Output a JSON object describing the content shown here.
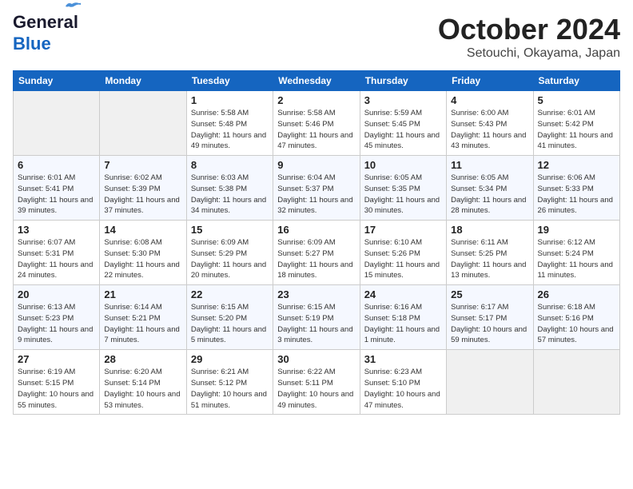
{
  "header": {
    "logo_line1": "General",
    "logo_line2": "Blue",
    "month": "October 2024",
    "location": "Setouchi, Okayama, Japan"
  },
  "weekdays": [
    "Sunday",
    "Monday",
    "Tuesday",
    "Wednesday",
    "Thursday",
    "Friday",
    "Saturday"
  ],
  "weeks": [
    [
      {
        "day": "",
        "sunrise": "",
        "sunset": "",
        "daylight": ""
      },
      {
        "day": "",
        "sunrise": "",
        "sunset": "",
        "daylight": ""
      },
      {
        "day": "1",
        "sunrise": "Sunrise: 5:58 AM",
        "sunset": "Sunset: 5:48 PM",
        "daylight": "Daylight: 11 hours and 49 minutes."
      },
      {
        "day": "2",
        "sunrise": "Sunrise: 5:58 AM",
        "sunset": "Sunset: 5:46 PM",
        "daylight": "Daylight: 11 hours and 47 minutes."
      },
      {
        "day": "3",
        "sunrise": "Sunrise: 5:59 AM",
        "sunset": "Sunset: 5:45 PM",
        "daylight": "Daylight: 11 hours and 45 minutes."
      },
      {
        "day": "4",
        "sunrise": "Sunrise: 6:00 AM",
        "sunset": "Sunset: 5:43 PM",
        "daylight": "Daylight: 11 hours and 43 minutes."
      },
      {
        "day": "5",
        "sunrise": "Sunrise: 6:01 AM",
        "sunset": "Sunset: 5:42 PM",
        "daylight": "Daylight: 11 hours and 41 minutes."
      }
    ],
    [
      {
        "day": "6",
        "sunrise": "Sunrise: 6:01 AM",
        "sunset": "Sunset: 5:41 PM",
        "daylight": "Daylight: 11 hours and 39 minutes."
      },
      {
        "day": "7",
        "sunrise": "Sunrise: 6:02 AM",
        "sunset": "Sunset: 5:39 PM",
        "daylight": "Daylight: 11 hours and 37 minutes."
      },
      {
        "day": "8",
        "sunrise": "Sunrise: 6:03 AM",
        "sunset": "Sunset: 5:38 PM",
        "daylight": "Daylight: 11 hours and 34 minutes."
      },
      {
        "day": "9",
        "sunrise": "Sunrise: 6:04 AM",
        "sunset": "Sunset: 5:37 PM",
        "daylight": "Daylight: 11 hours and 32 minutes."
      },
      {
        "day": "10",
        "sunrise": "Sunrise: 6:05 AM",
        "sunset": "Sunset: 5:35 PM",
        "daylight": "Daylight: 11 hours and 30 minutes."
      },
      {
        "day": "11",
        "sunrise": "Sunrise: 6:05 AM",
        "sunset": "Sunset: 5:34 PM",
        "daylight": "Daylight: 11 hours and 28 minutes."
      },
      {
        "day": "12",
        "sunrise": "Sunrise: 6:06 AM",
        "sunset": "Sunset: 5:33 PM",
        "daylight": "Daylight: 11 hours and 26 minutes."
      }
    ],
    [
      {
        "day": "13",
        "sunrise": "Sunrise: 6:07 AM",
        "sunset": "Sunset: 5:31 PM",
        "daylight": "Daylight: 11 hours and 24 minutes."
      },
      {
        "day": "14",
        "sunrise": "Sunrise: 6:08 AM",
        "sunset": "Sunset: 5:30 PM",
        "daylight": "Daylight: 11 hours and 22 minutes."
      },
      {
        "day": "15",
        "sunrise": "Sunrise: 6:09 AM",
        "sunset": "Sunset: 5:29 PM",
        "daylight": "Daylight: 11 hours and 20 minutes."
      },
      {
        "day": "16",
        "sunrise": "Sunrise: 6:09 AM",
        "sunset": "Sunset: 5:27 PM",
        "daylight": "Daylight: 11 hours and 18 minutes."
      },
      {
        "day": "17",
        "sunrise": "Sunrise: 6:10 AM",
        "sunset": "Sunset: 5:26 PM",
        "daylight": "Daylight: 11 hours and 15 minutes."
      },
      {
        "day": "18",
        "sunrise": "Sunrise: 6:11 AM",
        "sunset": "Sunset: 5:25 PM",
        "daylight": "Daylight: 11 hours and 13 minutes."
      },
      {
        "day": "19",
        "sunrise": "Sunrise: 6:12 AM",
        "sunset": "Sunset: 5:24 PM",
        "daylight": "Daylight: 11 hours and 11 minutes."
      }
    ],
    [
      {
        "day": "20",
        "sunrise": "Sunrise: 6:13 AM",
        "sunset": "Sunset: 5:23 PM",
        "daylight": "Daylight: 11 hours and 9 minutes."
      },
      {
        "day": "21",
        "sunrise": "Sunrise: 6:14 AM",
        "sunset": "Sunset: 5:21 PM",
        "daylight": "Daylight: 11 hours and 7 minutes."
      },
      {
        "day": "22",
        "sunrise": "Sunrise: 6:15 AM",
        "sunset": "Sunset: 5:20 PM",
        "daylight": "Daylight: 11 hours and 5 minutes."
      },
      {
        "day": "23",
        "sunrise": "Sunrise: 6:15 AM",
        "sunset": "Sunset: 5:19 PM",
        "daylight": "Daylight: 11 hours and 3 minutes."
      },
      {
        "day": "24",
        "sunrise": "Sunrise: 6:16 AM",
        "sunset": "Sunset: 5:18 PM",
        "daylight": "Daylight: 11 hours and 1 minute."
      },
      {
        "day": "25",
        "sunrise": "Sunrise: 6:17 AM",
        "sunset": "Sunset: 5:17 PM",
        "daylight": "Daylight: 10 hours and 59 minutes."
      },
      {
        "day": "26",
        "sunrise": "Sunrise: 6:18 AM",
        "sunset": "Sunset: 5:16 PM",
        "daylight": "Daylight: 10 hours and 57 minutes."
      }
    ],
    [
      {
        "day": "27",
        "sunrise": "Sunrise: 6:19 AM",
        "sunset": "Sunset: 5:15 PM",
        "daylight": "Daylight: 10 hours and 55 minutes."
      },
      {
        "day": "28",
        "sunrise": "Sunrise: 6:20 AM",
        "sunset": "Sunset: 5:14 PM",
        "daylight": "Daylight: 10 hours and 53 minutes."
      },
      {
        "day": "29",
        "sunrise": "Sunrise: 6:21 AM",
        "sunset": "Sunset: 5:12 PM",
        "daylight": "Daylight: 10 hours and 51 minutes."
      },
      {
        "day": "30",
        "sunrise": "Sunrise: 6:22 AM",
        "sunset": "Sunset: 5:11 PM",
        "daylight": "Daylight: 10 hours and 49 minutes."
      },
      {
        "day": "31",
        "sunrise": "Sunrise: 6:23 AM",
        "sunset": "Sunset: 5:10 PM",
        "daylight": "Daylight: 10 hours and 47 minutes."
      },
      {
        "day": "",
        "sunrise": "",
        "sunset": "",
        "daylight": ""
      },
      {
        "day": "",
        "sunrise": "",
        "sunset": "",
        "daylight": ""
      }
    ]
  ]
}
